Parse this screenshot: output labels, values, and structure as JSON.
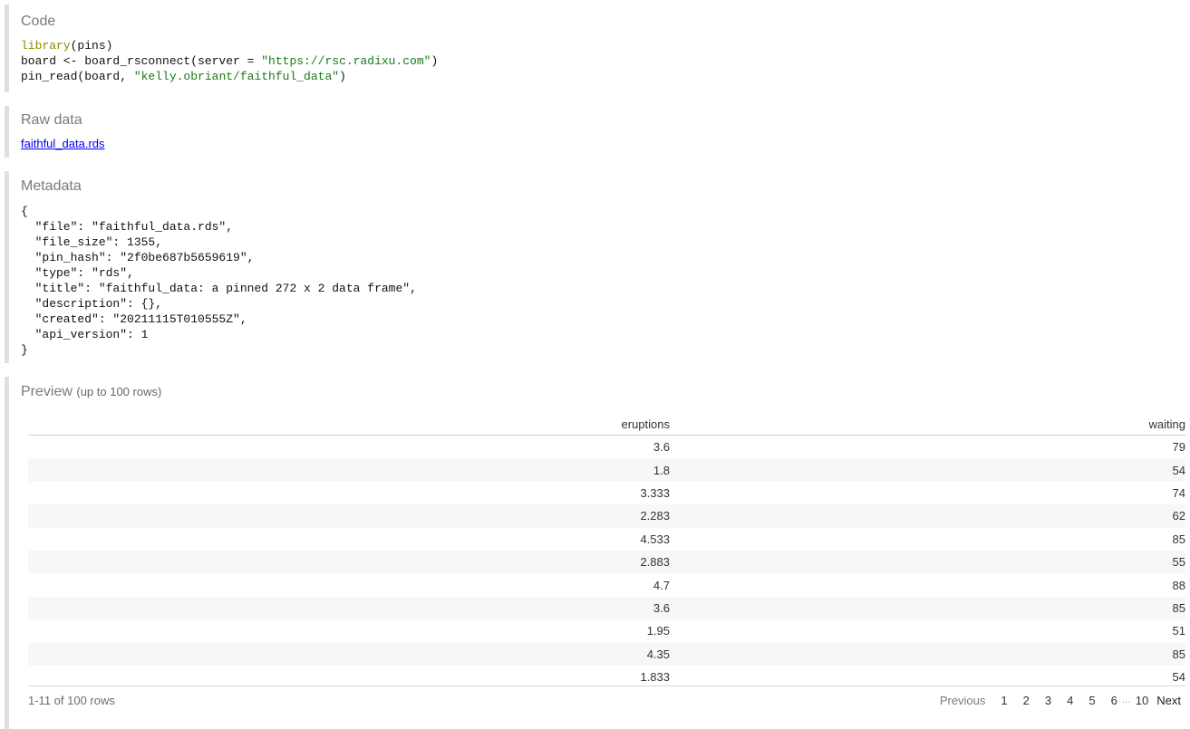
{
  "code": {
    "title": "Code",
    "line1_fn": "library",
    "line1_rest": "(pins)",
    "line2_pre": "board <- board_rsconnect(server = ",
    "line2_str": "\"https://rsc.radixu.com\"",
    "line2_post": ")",
    "line3_pre": "pin_read(board, ",
    "line3_str": "\"kelly.obriant/faithful_data\"",
    "line3_post": ")"
  },
  "raw": {
    "title": "Raw data",
    "link": "faithful_data.rds"
  },
  "metadata": {
    "title": "Metadata",
    "json_text": "{\n  \"file\": \"faithful_data.rds\",\n  \"file_size\": 1355,\n  \"pin_hash\": \"2f0be687b5659619\",\n  \"type\": \"rds\",\n  \"title\": \"faithful_data: a pinned 272 x 2 data frame\",\n  \"description\": {},\n  \"created\": \"20211115T010555Z\",\n  \"api_version\": 1\n}"
  },
  "preview": {
    "title": "Preview",
    "subtitle": "(up to 100 rows)",
    "columns": [
      "eruptions",
      "waiting"
    ],
    "rows": [
      [
        "3.6",
        "79"
      ],
      [
        "1.8",
        "54"
      ],
      [
        "3.333",
        "74"
      ],
      [
        "2.283",
        "62"
      ],
      [
        "4.533",
        "85"
      ],
      [
        "2.883",
        "55"
      ],
      [
        "4.7",
        "88"
      ],
      [
        "3.6",
        "85"
      ],
      [
        "1.95",
        "51"
      ],
      [
        "4.35",
        "85"
      ],
      [
        "1.833",
        "54"
      ]
    ],
    "row_info": "1-11 of 100 rows",
    "pager": {
      "previous": "Previous",
      "pages": [
        "1",
        "2",
        "3",
        "4",
        "5",
        "6"
      ],
      "ellipsis": "…",
      "last": "10",
      "next": "Next"
    }
  }
}
